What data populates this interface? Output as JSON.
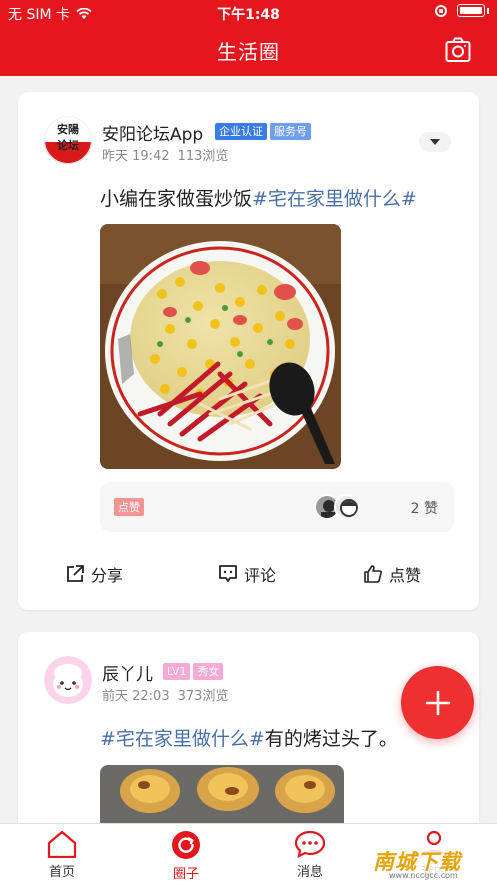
{
  "status_bar": {
    "carrier": "无 SIM 卡",
    "time": "下午1:48"
  },
  "nav": {
    "title": "生活圈",
    "camera_icon": "camera-icon"
  },
  "posts": [
    {
      "author": "安阳论坛App",
      "avatar_text": "安陽论坛",
      "badges": [
        "企业认证",
        "服务号"
      ],
      "time": "昨天 19:42",
      "views": "113浏览",
      "text_plain": "小编在家做蛋炒饭",
      "topic": "#宅在家里做什么#",
      "like_tag": "点赞",
      "like_count": "2 赞",
      "actions": {
        "share": "分享",
        "comment": "评论",
        "like": "点赞"
      }
    },
    {
      "author": "辰丫儿",
      "badges": [
        "LV1",
        "秀女"
      ],
      "time": "前天 22:03",
      "views": "373浏览",
      "topic": "#宅在家里做什么#",
      "text_plain": "有的烤过头了。"
    }
  ],
  "colors": {
    "brand_red": "#e5171e",
    "topic_blue": "#4a6fa8",
    "badge_blue": "#3b7be8",
    "badge_lightblue": "#6e9ef0",
    "badge_pink": "#f5a9d6"
  },
  "tabbar": [
    {
      "label": "首页",
      "icon": "home-icon"
    },
    {
      "label": "圈子",
      "icon": "circle-refresh-icon"
    },
    {
      "label": "消息",
      "icon": "chat-icon"
    },
    {
      "label": "我的",
      "icon": "person-icon"
    }
  ],
  "watermark": {
    "text": "南城下载",
    "sub": "www.nccgcc.com"
  }
}
